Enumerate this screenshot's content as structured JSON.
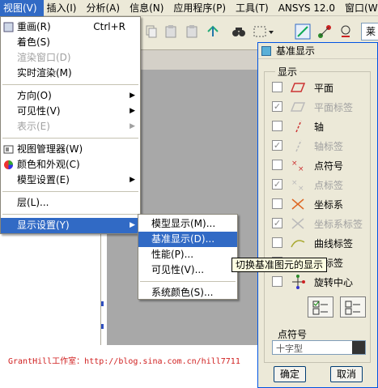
{
  "menubar": {
    "items": [
      {
        "label": "视图(V)"
      },
      {
        "label": "插入(I)"
      },
      {
        "label": "分析(A)"
      },
      {
        "label": "信息(N)"
      },
      {
        "label": "应用程序(P)"
      },
      {
        "label": "工具(T)"
      },
      {
        "label": "ANSYS 12.0"
      },
      {
        "label": "窗口(W)"
      }
    ]
  },
  "toolbar": {
    "partial_button": "莱"
  },
  "view_menu": {
    "items": [
      {
        "label": "重画(R)",
        "accel": "Ctrl+R"
      },
      {
        "label": "着色(S)"
      },
      {
        "label": "渲染窗口(D)"
      },
      {
        "label": "实时渲染(M)"
      },
      {
        "label": "方向(O)"
      },
      {
        "label": "可见性(V)"
      },
      {
        "label": "表示(E)"
      },
      {
        "label": "视图管理器(W)"
      },
      {
        "label": "颜色和外观(C)"
      },
      {
        "label": "模型设置(E)"
      },
      {
        "label": "层(L)..."
      },
      {
        "label": "显示设置(Y)"
      }
    ]
  },
  "display_submenu": {
    "items": [
      {
        "label": "模型显示(M)..."
      },
      {
        "label": "基准显示(D)..."
      },
      {
        "label": "性能(P)..."
      },
      {
        "label": "可见性(V)..."
      },
      {
        "label": "系统颜色(S)..."
      }
    ]
  },
  "tooltip": {
    "text": "切换基准图元的显示"
  },
  "watermark": {
    "text": "GrantHill工作室：http://blog.sina.com.cn/hill7711"
  },
  "dialog": {
    "title": "基准显示",
    "group_label": "显示",
    "options": [
      {
        "label": "平面",
        "checked": false,
        "enabled": true
      },
      {
        "label": "平面标签",
        "checked": true,
        "enabled": false
      },
      {
        "label": "轴",
        "checked": false,
        "enabled": true
      },
      {
        "label": "轴标签",
        "checked": true,
        "enabled": false
      },
      {
        "label": "点符号",
        "checked": false,
        "enabled": true
      },
      {
        "label": "点标签",
        "checked": true,
        "enabled": false
      },
      {
        "label": "坐标系",
        "checked": false,
        "enabled": true
      },
      {
        "label": "坐标系标签",
        "checked": true,
        "enabled": false
      },
      {
        "label": "曲线标签",
        "checked": false,
        "enabled": true
      },
      {
        "label": "面标签",
        "checked": false,
        "enabled": true
      },
      {
        "label": "旋转中心",
        "checked": false,
        "enabled": true
      }
    ],
    "point_label": "点符号",
    "point_value": "十字型",
    "ok": "确定",
    "cancel": "取消"
  },
  "colors": {
    "highlight": "#316ac5",
    "menubg": "#ece9d8",
    "viewgray": "#a8a8a8"
  }
}
